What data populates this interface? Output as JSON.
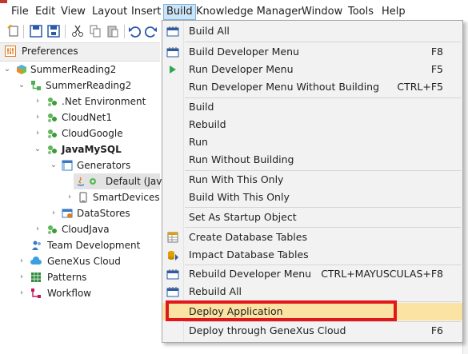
{
  "menubar": {
    "items": [
      "File",
      "Edit",
      "View",
      "Layout",
      "Insert",
      "Build",
      "Knowledge Manager",
      "Window",
      "Tools",
      "Help"
    ],
    "active": "Build"
  },
  "preferences": {
    "label": "Preferences"
  },
  "tree": [
    {
      "label": "SummerReading2",
      "icon": "kb-icon",
      "expanded": true
    },
    {
      "label": "SummerReading2",
      "icon": "version-icon",
      "expanded": true
    },
    {
      "label": ".Net Environment",
      "icon": "environment-icon",
      "expanded": false
    },
    {
      "label": "CloudNet1",
      "icon": "environment-icon",
      "expanded": false
    },
    {
      "label": "CloudGoogle",
      "icon": "environment-icon",
      "expanded": false
    },
    {
      "label": "JavaMySQL",
      "icon": "environment-icon",
      "expanded": true,
      "bold": true
    },
    {
      "label": "Generators",
      "icon": "generators-icon",
      "expanded": true
    },
    {
      "label": "Default (Java",
      "icon": "java-icon",
      "expanded": false
    },
    {
      "label": "SmartDevices (S",
      "icon": "device-icon",
      "expanded": false
    },
    {
      "label": "DataStores",
      "icon": "datastores-icon",
      "expanded": false
    },
    {
      "label": "CloudJava",
      "icon": "environment-icon",
      "expanded": false
    },
    {
      "label": "Team Development",
      "icon": "team-icon",
      "expanded": false
    },
    {
      "label": "GeneXus Cloud",
      "icon": "cloud-icon",
      "expanded": false
    },
    {
      "label": "Patterns",
      "icon": "patterns-icon",
      "expanded": false
    },
    {
      "label": "Workflow",
      "icon": "workflow-icon",
      "expanded": false
    }
  ],
  "build_menu": {
    "build_all": "Build All",
    "build_dev_menu": "Build Developer Menu",
    "build_dev_menu_key": "F8",
    "run_dev_menu": "Run Developer Menu",
    "run_dev_menu_key": "F5",
    "run_dev_menu_nobuild": "Run Developer Menu Without Building",
    "run_dev_menu_nobuild_key": "CTRL+F5",
    "build": "Build",
    "rebuild": "Rebuild",
    "run": "Run",
    "run_without_building": "Run Without Building",
    "run_with_this_only": "Run With This Only",
    "build_with_this_only": "Build With This Only",
    "set_startup": "Set As Startup Object",
    "create_db_tables": "Create Database Tables",
    "impact_db_tables": "Impact Database Tables",
    "rebuild_dev_menu": "Rebuild Developer Menu",
    "rebuild_dev_menu_key": "CTRL+MAYUSCULAS+F8",
    "rebuild_all": "Rebuild All",
    "deploy_application": "Deploy Application",
    "deploy_cloud": "Deploy through GeneXus Cloud",
    "deploy_cloud_key": "F6"
  },
  "colors": {
    "highlight": "#fbe3a4",
    "annotation": "#e2171b",
    "active_menu": "#cce4f7"
  }
}
